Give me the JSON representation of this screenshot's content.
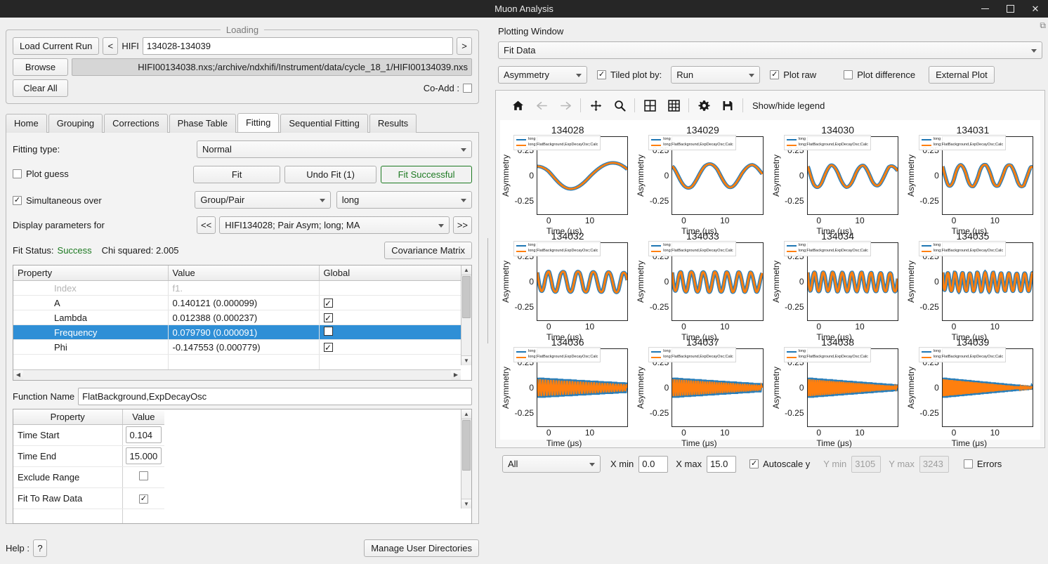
{
  "window": {
    "title": "Muon Analysis",
    "minimize": "–",
    "maximize": "☐",
    "close": "✕"
  },
  "loading": {
    "group_title": "Loading",
    "load_current_run": "Load Current Run",
    "prev_button": "<",
    "next_button": ">",
    "instrument_label": "HIFI",
    "run_range": "134028-134039",
    "browse": "Browse",
    "file_path": "HIFI00134038.nxs;/archive/ndxhifi/Instrument/data/cycle_18_1/HIFI00134039.nxs",
    "clear_all": "Clear All",
    "coadd_label": "Co-Add :",
    "coadd_checked": false
  },
  "tabs": [
    {
      "label": "Home",
      "active": false
    },
    {
      "label": "Grouping",
      "active": false
    },
    {
      "label": "Corrections",
      "active": false
    },
    {
      "label": "Phase Table",
      "active": false
    },
    {
      "label": "Fitting",
      "active": true
    },
    {
      "label": "Sequential Fitting",
      "active": false
    },
    {
      "label": "Results",
      "active": false
    }
  ],
  "fitting": {
    "fitting_type_label": "Fitting type:",
    "fitting_type_value": "Normal",
    "plot_guess_label": "Plot guess",
    "plot_guess_checked": false,
    "fit_button": "Fit",
    "undo_fit_button": "Undo Fit (1)",
    "fit_status_button": "Fit Successful",
    "simultaneous_label": "Simultaneous over",
    "simultaneous_checked": true,
    "simultaneous_over_value": "Group/Pair",
    "simultaneous_target_value": "long",
    "display_params_label": "Display parameters for",
    "display_prev": "<<",
    "display_next": ">>",
    "display_params_value": "HIFI134028; Pair Asym; long; MA",
    "fit_status_label": "Fit Status:",
    "fit_status_value": "Success",
    "chi_squared_label": "Chi squared: 2.005",
    "covariance_button": "Covariance Matrix",
    "param_table": {
      "headers": [
        "Property",
        "Value",
        "Global"
      ],
      "rows": [
        {
          "property": "Index",
          "value": "f1.",
          "global": "",
          "ghost": true,
          "selected": false
        },
        {
          "property": "A",
          "value": "0.140121 (0.000099)",
          "global": "✓",
          "ghost": false,
          "selected": false
        },
        {
          "property": "Lambda",
          "value": "0.012388 (0.000237)",
          "global": "✓",
          "ghost": false,
          "selected": false
        },
        {
          "property": "Frequency",
          "value": "0.079790 (0.000091)",
          "global": "",
          "ghost": false,
          "selected": true
        },
        {
          "property": "Phi",
          "value": "-0.147553 (0.000779)",
          "global": "✓",
          "ghost": false,
          "selected": false
        }
      ]
    },
    "function_name_label": "Function Name",
    "function_name_value": "FlatBackground,ExpDecayOsc",
    "fn_table": {
      "headers": [
        "Property",
        "Value"
      ],
      "rows": [
        {
          "property": "Time Start",
          "value": "0.104",
          "kind": "input"
        },
        {
          "property": "Time End",
          "value": "15.000",
          "kind": "input"
        },
        {
          "property": "Exclude Range",
          "value": "",
          "kind": "checkbox",
          "checked": false
        },
        {
          "property": "Fit To Raw Data",
          "value": "✓",
          "kind": "checkbox",
          "checked": true
        }
      ]
    }
  },
  "footer": {
    "help_label": "Help :",
    "help_button": "?",
    "manage_dirs_button": "Manage User Directories"
  },
  "plotting": {
    "window_title": "Plotting Window",
    "float_icon": "⧉",
    "mode_value": "Fit Data",
    "data_type_value": "Asymmetry",
    "tiled_plot_label": "Tiled plot by:",
    "tiled_plot_checked": true,
    "tiled_by_value": "Run",
    "plot_raw_label": "Plot raw",
    "plot_raw_checked": true,
    "plot_difference_label": "Plot difference",
    "plot_difference_checked": false,
    "external_plot_button": "External Plot",
    "toolbar": [
      {
        "name": "home-icon",
        "glyph": "home",
        "disabled": false
      },
      {
        "name": "back-arrow-icon",
        "glyph": "←",
        "disabled": true
      },
      {
        "name": "forward-arrow-icon",
        "glyph": "→",
        "disabled": true
      },
      {
        "name": "pan-icon",
        "glyph": "move",
        "disabled": false
      },
      {
        "name": "zoom-icon",
        "glyph": "magnifier",
        "disabled": false
      },
      {
        "name": "subplots-icon",
        "glyph": "grid2",
        "disabled": false
      },
      {
        "name": "grid-icon",
        "glyph": "grid3",
        "disabled": false
      },
      {
        "name": "settings-gear-icon",
        "glyph": "gear",
        "disabled": false
      },
      {
        "name": "save-icon",
        "glyph": "floppy",
        "disabled": false
      }
    ],
    "legend_toggle_label": "Show/hide legend",
    "bottom": {
      "range_select_value": "All",
      "xmin_label": "X min",
      "xmin_value": "0.0",
      "xmax_label": "X max",
      "xmax_value": "15.0",
      "autoscale_label": "Autoscale y",
      "autoscale_checked": true,
      "ymin_label": "Y min",
      "ymin_value": "3105",
      "ymax_label": "Y max",
      "ymax_value": "3243",
      "errors_label": "Errors",
      "errors_checked": false
    }
  },
  "chart_data": {
    "type": "line",
    "layout": {
      "rows": 3,
      "cols": 4,
      "tiled_by": "Run"
    },
    "xlabel": "Time (μs)",
    "ylabel": "Asymmetry",
    "xlim": [
      0,
      15
    ],
    "ylim": [
      -0.35,
      0.35
    ],
    "xticks": [
      0,
      10
    ],
    "yticks": [
      -0.25,
      0,
      0.25
    ],
    "ytick_labels": [
      "-0.25",
      "0",
      "0.25"
    ],
    "grid": false,
    "legend_position": "upper left",
    "legend": [
      {
        "label": "long",
        "color": "#1f77b4"
      },
      {
        "label": "long;FlatBackground,ExpDecayOsc;Calc",
        "color": "#ff7f0e"
      }
    ],
    "series_colors": {
      "raw": "#1f77b4",
      "fit": "#ff7f0e"
    },
    "fit_parameters": {
      "A": 0.140121,
      "Lambda": 0.012388,
      "Frequency": 0.07979,
      "Phi": -0.147553
    },
    "panels": [
      {
        "title": "134028",
        "frequency": 0.0798,
        "amplitude": 0.115,
        "lambda": 0.012,
        "phi": -0.148
      },
      {
        "title": "134029",
        "frequency": 0.15,
        "amplitude": 0.115,
        "lambda": 0.012,
        "phi": -0.148
      },
      {
        "title": "134030",
        "frequency": 0.23,
        "amplitude": 0.115,
        "lambda": 0.012,
        "phi": -0.148
      },
      {
        "title": "134031",
        "frequency": 0.3,
        "amplitude": 0.115,
        "lambda": 0.012,
        "phi": -0.148
      },
      {
        "title": "134032",
        "frequency": 0.42,
        "amplitude": 0.115,
        "lambda": 0.012,
        "phi": -0.148
      },
      {
        "title": "134033",
        "frequency": 0.54,
        "amplitude": 0.115,
        "lambda": 0.012,
        "phi": -0.148
      },
      {
        "title": "134034",
        "frequency": 0.66,
        "amplitude": 0.115,
        "lambda": 0.012,
        "phi": -0.148
      },
      {
        "title": "134035",
        "frequency": 0.8,
        "amplitude": 0.115,
        "lambda": 0.012,
        "phi": -0.148
      },
      {
        "title": "134036",
        "frequency": 1.05,
        "amplitude": 0.115,
        "lambda": 0.012,
        "phi": -0.148
      },
      {
        "title": "134037",
        "frequency": 1.25,
        "amplitude": 0.115,
        "lambda": 0.012,
        "phi": -0.148
      },
      {
        "title": "134038",
        "frequency": 1.5,
        "amplitude": 0.115,
        "lambda": 0.012,
        "phi": -0.148
      },
      {
        "title": "134039",
        "frequency": 1.8,
        "amplitude": 0.115,
        "lambda": 0.012,
        "phi": -0.148
      }
    ]
  }
}
